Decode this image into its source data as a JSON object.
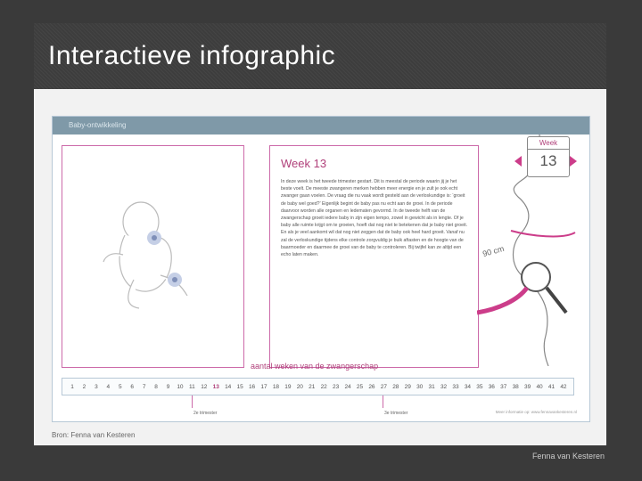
{
  "slide": {
    "title": "Interactieve infographic",
    "footer_author": "Fenna van Kesteren",
    "source": "Bron: Fenna van Kesteren"
  },
  "infographic": {
    "header": "Baby-ontwikkeling",
    "week_heading": "Week 13",
    "week_text": "In deze week is het tweede trimester gestart. Dit is meestal de periode waarin jij je het beste voelt. De meeste zwangeren merken hebben meer energie en je zult je ook echt zwanger gaan voelen. De vraag die nu vaak wordt gesteld aan de verloskundige is: ‘groeit de baby wel goed?’ Eigenlijk begint de baby pas nu echt aan de groei. In de periode daarvoor worden alle organen en ledematen gevormd. In de tweede helft van de zwangerschap groeit iedere baby in zijn eigen tempo, zowel in gewicht als in lengte. Of je baby alle ruimte krijgt om te groeien, hoeft dat nog niet te betekenen dat je baby niet groeit. En als je veel aankomt wil dat nog niet zeggen dat de baby ook heel hard groeit. Vanaf nu zal de verloskundige tijdens elke controle zorgvuldig je buik aftasten en de hoogte van de baarmoeder en daarmee de groei van de baby te controleren. Bij twijfel kan ze altijd een echo laten maken.",
    "week_card": {
      "label": "Week",
      "value": "13"
    },
    "measure_label": "90 cm",
    "axis_title": "aantal weken van de zwangerschap",
    "weeks": [
      "1",
      "2",
      "3",
      "4",
      "5",
      "6",
      "7",
      "8",
      "9",
      "10",
      "11",
      "12",
      "13",
      "14",
      "15",
      "16",
      "17",
      "18",
      "19",
      "20",
      "21",
      "22",
      "23",
      "24",
      "25",
      "26",
      "27",
      "28",
      "29",
      "30",
      "31",
      "32",
      "33",
      "34",
      "35",
      "36",
      "37",
      "38",
      "39",
      "40",
      "41",
      "42"
    ],
    "active_week": "13",
    "trimester_2": "2e trimester",
    "trimester_3": "3e trimester",
    "credit": "Meer informatie op: www.fennavankesteren.nl"
  },
  "colors": {
    "accent": "#cc3d8a",
    "panel_border": "#cc6aa9",
    "header_bg": "#7f99a8"
  }
}
